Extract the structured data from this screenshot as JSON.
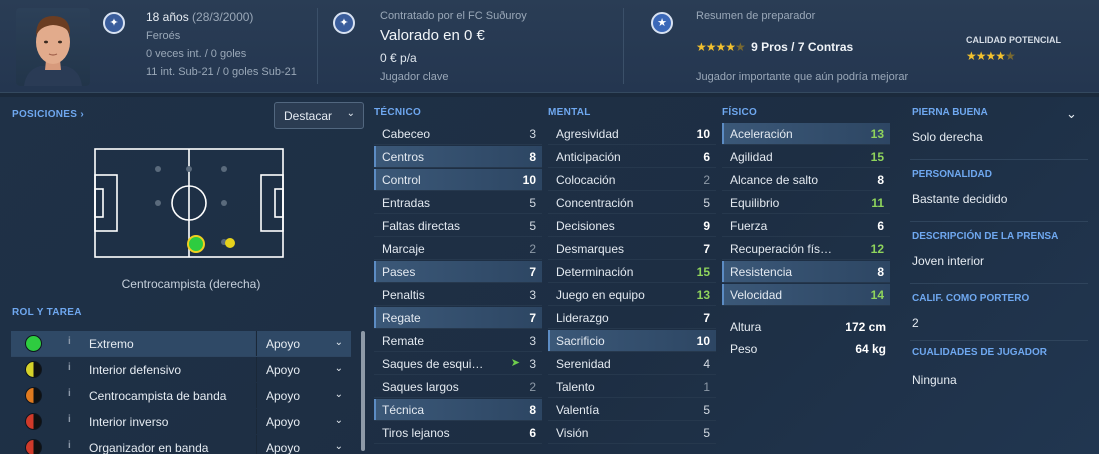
{
  "header": {
    "age_label": "18 años",
    "birth_date": "(28/3/2000)",
    "nationality": "Feroés",
    "caps": "0 veces int. / 0 goles",
    "u21_caps": "11 int. Sub-21 / 0 goles Sub-21",
    "contract_label": "Contratado por el FC Suðuroy",
    "value": "Valorado en 0 €",
    "wage": "0 € p/a",
    "squad_status": "Jugador clave",
    "coach_report_title": "Resumen de preparador",
    "pros_cons": "9 Pros / 7 Contras",
    "coach_stars": 4.5,
    "coach_summary": "Jugador importante que aún podría mejorar",
    "potential_title": "CALIDAD POTENCIAL",
    "potential_stars": 4.5
  },
  "positions": {
    "title": "POSICIONES ›",
    "highlight_select": "Destacar",
    "caption": "Centrocampista (derecha)"
  },
  "roles": {
    "title": "ROL Y TAREA",
    "items": [
      {
        "name": "Extremo",
        "duty": "Apoyo",
        "color_top": "#2ecc40",
        "color_bottom": "#2ecc40"
      },
      {
        "name": "Interior defensivo",
        "duty": "Apoyo",
        "color_top": "#d6d22a",
        "color_bottom": "#111111"
      },
      {
        "name": "Centrocampista de banda",
        "duty": "Apoyo",
        "color_top": "#e07a1f",
        "color_bottom": "#111111"
      },
      {
        "name": "Interior inverso",
        "duty": "Apoyo",
        "color_top": "#d03a2a",
        "color_bottom": "#111111"
      },
      {
        "name": "Organizador en banda",
        "duty": "Apoyo",
        "color_top": "#d03a2a",
        "color_bottom": "#111111"
      }
    ]
  },
  "technical": {
    "title": "TÉCNICO",
    "attrs": [
      {
        "name": "Cabeceo",
        "value": "3"
      },
      {
        "name": "Centros",
        "value": "8"
      },
      {
        "name": "Control",
        "value": "10"
      },
      {
        "name": "Entradas",
        "value": "5"
      },
      {
        "name": "Faltas directas",
        "value": "5"
      },
      {
        "name": "Marcaje",
        "value": "2"
      },
      {
        "name": "Pases",
        "value": "7"
      },
      {
        "name": "Penaltis",
        "value": "3"
      },
      {
        "name": "Regate",
        "value": "7"
      },
      {
        "name": "Remate",
        "value": "3"
      },
      {
        "name": "Saques de esqui…",
        "value": "3"
      },
      {
        "name": "Saques largos",
        "value": "2"
      },
      {
        "name": "Técnica",
        "value": "8"
      },
      {
        "name": "Tiros lejanos",
        "value": "6"
      }
    ]
  },
  "mental": {
    "title": "MENTAL",
    "attrs": [
      {
        "name": "Agresividad",
        "value": "10"
      },
      {
        "name": "Anticipación",
        "value": "6"
      },
      {
        "name": "Colocación",
        "value": "2"
      },
      {
        "name": "Concentración",
        "value": "5"
      },
      {
        "name": "Decisiones",
        "value": "9"
      },
      {
        "name": "Desmarques",
        "value": "7"
      },
      {
        "name": "Determinación",
        "value": "15"
      },
      {
        "name": "Juego en equipo",
        "value": "13"
      },
      {
        "name": "Liderazgo",
        "value": "7"
      },
      {
        "name": "Sacrificio",
        "value": "10"
      },
      {
        "name": "Serenidad",
        "value": "4"
      },
      {
        "name": "Talento",
        "value": "1"
      },
      {
        "name": "Valentía",
        "value": "5"
      },
      {
        "name": "Visión",
        "value": "5"
      }
    ]
  },
  "physical": {
    "title": "FÍSICO",
    "attrs": [
      {
        "name": "Aceleración",
        "value": "13"
      },
      {
        "name": "Agilidad",
        "value": "15"
      },
      {
        "name": "Alcance de salto",
        "value": "8"
      },
      {
        "name": "Equilibrio",
        "value": "11"
      },
      {
        "name": "Fuerza",
        "value": "6"
      },
      {
        "name": "Recuperación fís…",
        "value": "12"
      },
      {
        "name": "Resistencia",
        "value": "8"
      },
      {
        "name": "Velocidad",
        "value": "14"
      }
    ],
    "height_label": "Altura",
    "height_value": "172 cm",
    "weight_label": "Peso",
    "weight_value": "64 kg"
  },
  "info": {
    "foot_title": "PIERNA BUENA",
    "foot_value": "Solo derecha",
    "personality_title": "PERSONALIDAD",
    "personality_value": "Bastante decidido",
    "press_title": "DESCRIPCIÓN DE LA PRENSA",
    "press_value": "Joven interior",
    "gk_title": "CALIF. COMO PORTERO",
    "gk_value": "2",
    "qualities_title": "CUALIDADES DE JUGADOR",
    "qualities_value": "Ninguna"
  }
}
